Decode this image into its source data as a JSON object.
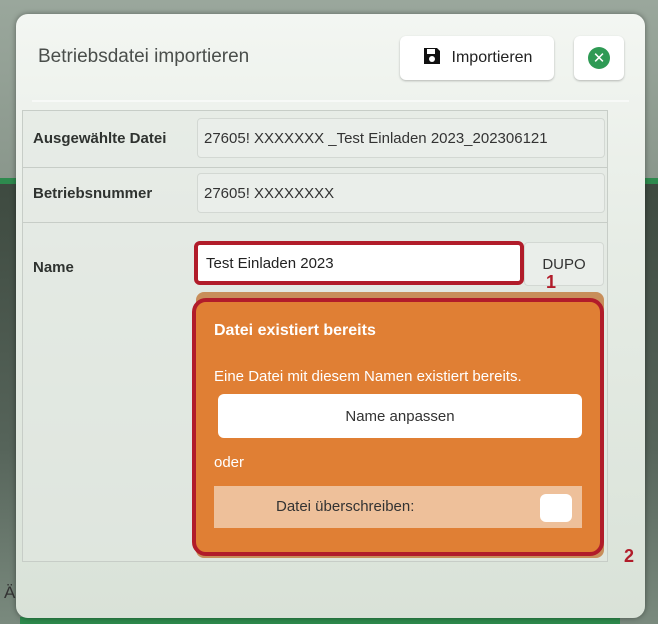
{
  "dialog": {
    "title": "Betriebsdatei importieren",
    "import_button": "Importieren",
    "close_icon": "close-circle-icon"
  },
  "form": {
    "selected_file_label": "Ausgewählte Datei",
    "selected_file_value": "27605!  XXXXXXX  _Test Einladen 2023_202306121",
    "farm_number_label": "Betriebsnummer",
    "farm_number_value": "27605!  XXXXXXXX",
    "name_label": "Name",
    "name_value": "Test Einladen 2023",
    "suffix": "DUPO"
  },
  "warning": {
    "title": "Datei existiert bereits",
    "message": "Eine Datei mit diesem Namen existiert bereits.",
    "rename_button": "Name anpassen",
    "or_text": "oder",
    "overwrite_label": "Datei überschreiben:"
  },
  "markers": {
    "one": "1",
    "two": "2"
  },
  "background": {
    "letter": "Ä"
  },
  "colors": {
    "accent_green": "#2e9a54",
    "warning_orange": "#e07f34",
    "highlight_red": "#b11c2a"
  }
}
